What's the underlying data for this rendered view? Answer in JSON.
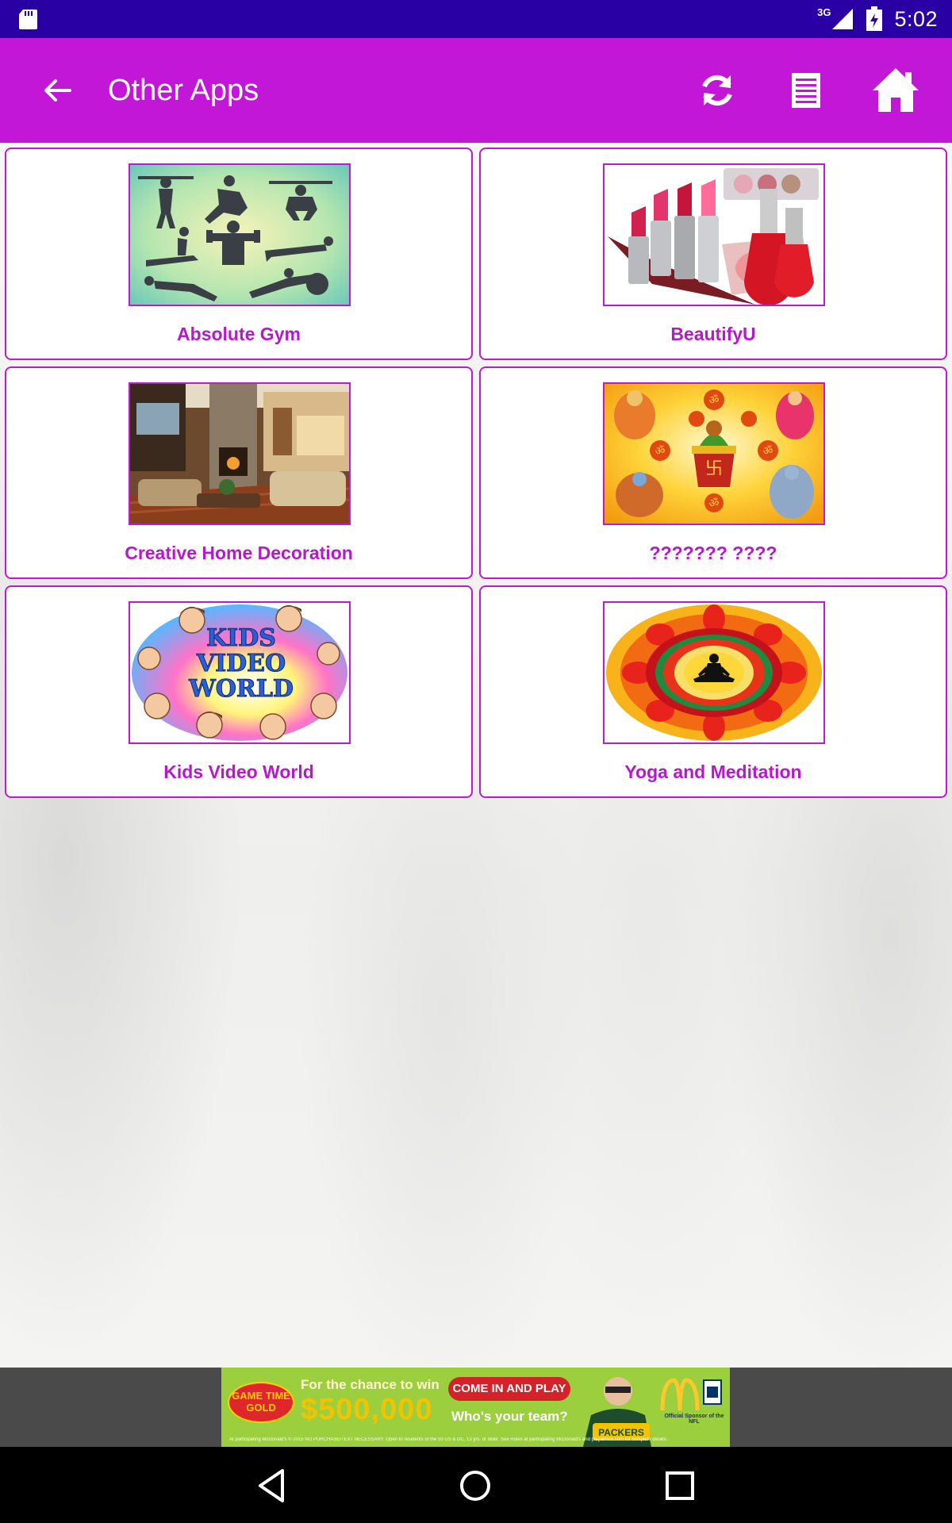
{
  "status_bar": {
    "network_label": "3G",
    "time": "5:02"
  },
  "app_bar": {
    "title": "Other Apps",
    "background_color": "#c217d6",
    "icons": [
      "back-arrow-icon",
      "refresh-icon",
      "list-icon",
      "home-icon"
    ]
  },
  "apps": [
    {
      "name": "Absolute Gym",
      "image": "gym-silhouettes"
    },
    {
      "name": "BeautifyU",
      "image": "cosmetics"
    },
    {
      "name": "Creative Home Decoration",
      "image": "living-room"
    },
    {
      "name": "??????? ????",
      "image": "hindu-deities"
    },
    {
      "name": "Kids Video World",
      "image": "kids-logo"
    },
    {
      "name": "Yoga and Meditation",
      "image": "yoga-mandala"
    }
  ],
  "ad": {
    "badge": "GAME TIME GOLD",
    "headline": "For the chance to win",
    "amount": "$500,000",
    "cta": "COME IN AND PLAY",
    "tagline": "Who's your team?",
    "sponsor": "Official Sponsor of the NFL",
    "fine_print": "At participating McDonald's © 2015 NO PURCHASE/TEXT NECESSARY. Open to residents of the 50 US & DC, 13 yrs. or older. See Rules at participating McDonald's and playatmcd.com for complete details."
  },
  "nav_bar": {
    "icons": [
      "nav-back-icon",
      "nav-home-icon",
      "nav-recents-icon"
    ]
  }
}
